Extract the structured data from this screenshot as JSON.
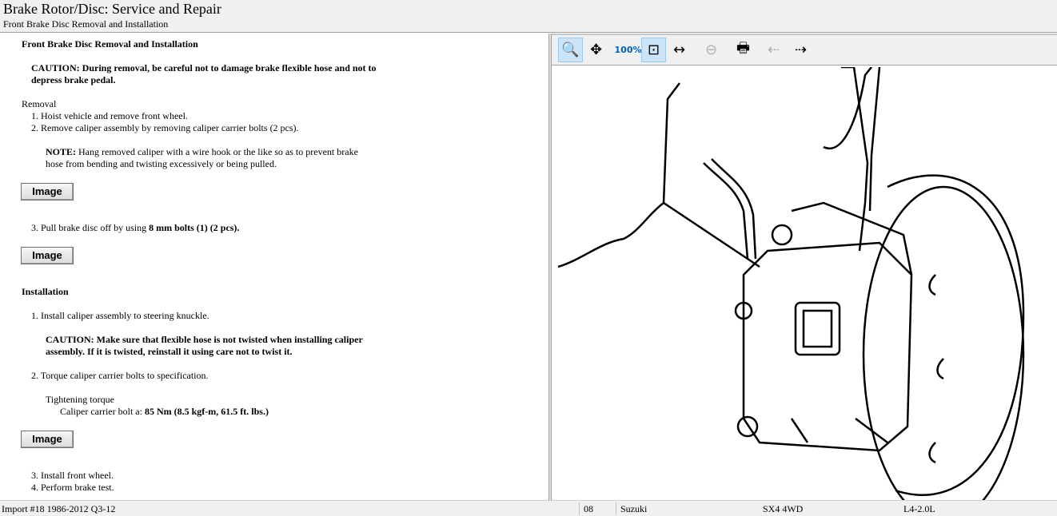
{
  "header": {
    "title": "Brake Rotor/Disc:  Service and Repair",
    "subtitle": "Front Brake Disc Removal and Installation"
  },
  "doc": {
    "heading": "Front Brake Disc Removal and Installation",
    "caution1_a": "CAUTION: During removal, be careful not to damage brake flexible hose and not to",
    "caution1_b": "depress brake pedal.",
    "removal": "Removal",
    "r1": "1.  Hoist vehicle and remove front wheel.",
    "r2": "2.  Remove caliper assembly by removing caliper carrier bolts (2 pcs).",
    "note_label": "NOTE:",
    "note_a": " Hang removed caliper with a wire hook or the like so as to prevent brake",
    "note_b": "hose from bending and twisting excessively or being pulled.",
    "r3_a": "3.  Pull brake disc off by using ",
    "r3_b": "8 mm bolts (1) (2 pcs).",
    "installation": "Installation",
    "i1": "1.  Install caliper assembly to steering knuckle.",
    "caution2_a": "CAUTION: Make sure that flexible hose is not twisted when installing caliper",
    "caution2_b": "assembly. If it is twisted, reinstall it using care not to twist it.",
    "i2": "2.  Torque caliper carrier bolts to specification.",
    "torque_label": "Tightening torque",
    "torque_a": "Caliper carrier bolt a: ",
    "torque_b": "85 Nm (8.5 kgf-m, 61.5 ft. lbs.)",
    "i3": "3.   Install front wheel.",
    "i4": "4.  Perform brake test.",
    "image_button": "Image"
  },
  "toolbar": {
    "buttons": [
      "zoom-in-icon",
      "pan-icon",
      "actual-size-icon",
      "fit-icon",
      "fit-width-icon",
      "zoom-out-icon",
      "print-icon",
      "previous-image-icon",
      "next-image-icon"
    ]
  },
  "status": {
    "source": "Import #18 1986-2012 Q3-12",
    "year": "08",
    "make": "Suzuki",
    "model": "SX4 4WD",
    "engine": "L4-2.0L"
  }
}
